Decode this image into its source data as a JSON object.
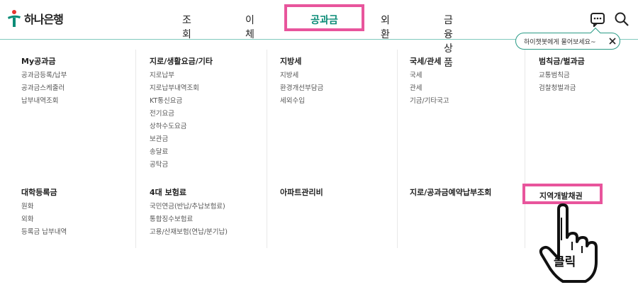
{
  "brand": {
    "name": "하나은행"
  },
  "nav": {
    "items": [
      "조회",
      "이체",
      "외환",
      "금융상품"
    ],
    "active": "공과금"
  },
  "tooltip": {
    "text": "하이챗봇에게 물어보세요~"
  },
  "menu": {
    "columns": [
      {
        "title": "My공과금",
        "items": [
          "공과금등록/납부",
          "공과금스케줄러",
          "납부내역조회"
        ]
      },
      {
        "title": "지로/생활요금/기타",
        "items": [
          "지로납부",
          "지로납부내역조회",
          "KT통신요금",
          "전기요금",
          "상하수도요금",
          "보관금",
          "송달료",
          "공탁금"
        ]
      },
      {
        "title": "지방세",
        "items": [
          "지방세",
          "환경개선부담금",
          "세외수입"
        ]
      },
      {
        "title": "국세/관세",
        "items": [
          "국세",
          "관세",
          "기금/기타국고"
        ]
      },
      {
        "title": "범칙금/벌과금",
        "items": [
          "교통범칙금",
          "검찰청벌과금"
        ]
      },
      {
        "title": "대학등록금",
        "items": [
          "원화",
          "외화",
          "등록금 납부내역"
        ]
      },
      {
        "title": "4대 보험료",
        "items": [
          "국민연금(반납/추납보험료)",
          "통합징수보험료",
          "고용/산재보험(연납/분기납)"
        ]
      },
      {
        "title": "아파트관리비",
        "items": []
      },
      {
        "title": "지로/공과금예약납부조회",
        "items": []
      }
    ],
    "highlighted": "지역개발채권"
  },
  "annotation": {
    "hand_label": "클릭"
  },
  "colors": {
    "accent": "#0c8c77",
    "highlight": "#e8559c"
  }
}
